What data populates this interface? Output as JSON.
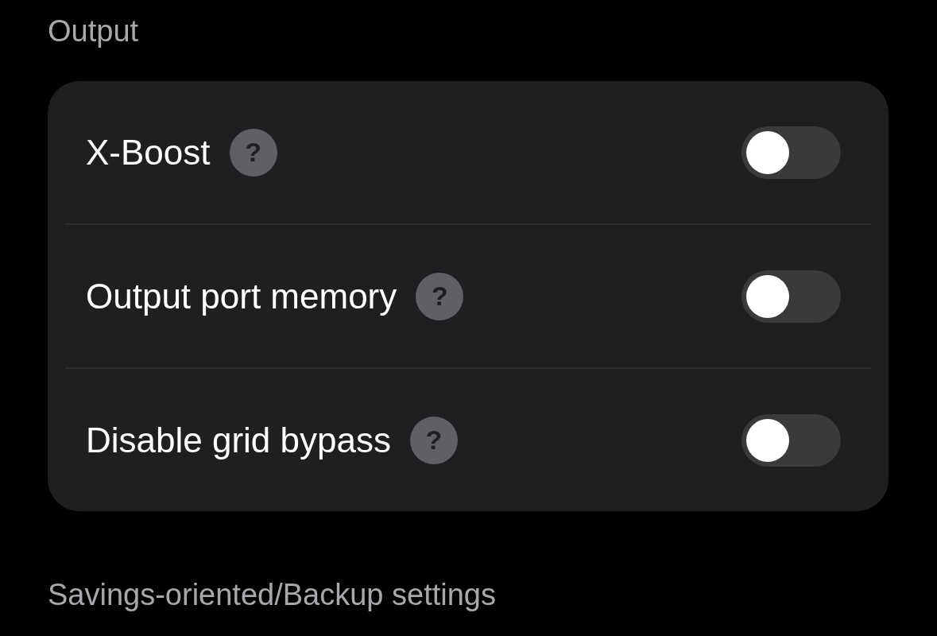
{
  "sections": [
    {
      "title": "Output",
      "settings": [
        {
          "label": "X-Boost",
          "help": "?",
          "on": false
        },
        {
          "label": "Output port memory",
          "help": "?",
          "on": false
        },
        {
          "label": "Disable grid bypass",
          "help": "?",
          "on": false
        }
      ]
    },
    {
      "title": "Savings-oriented/Backup settings"
    }
  ]
}
